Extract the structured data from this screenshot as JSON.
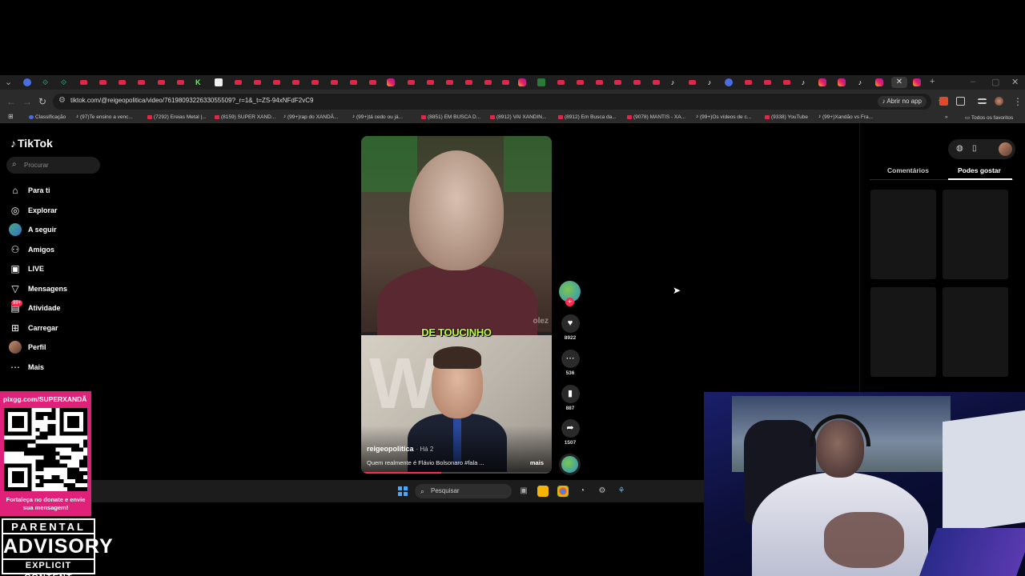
{
  "browser": {
    "url": "tiktok.com/@reigeopolitica/video/7619809322633055509?_r=1&_t=ZS-94xNFdF2vC9",
    "open_app_label": "Abrir no app",
    "bookmarks": [
      {
        "label": "Classificação",
        "icon": "google"
      },
      {
        "label": "(97)Te ensino a venc...",
        "icon": "tiktok"
      },
      {
        "label": "(7292) Ereias Metal |...",
        "icon": "youtube"
      },
      {
        "label": "(8159) SUPER XAND...",
        "icon": "youtube"
      },
      {
        "label": "(99+)rap do XANDÃ...",
        "icon": "tiktok"
      },
      {
        "label": "(99+)tá cedo ou já...",
        "icon": "tiktok"
      },
      {
        "label": "(8851) EM BUSCA D...",
        "icon": "youtube"
      },
      {
        "label": "(8912) VAI XANDIN...",
        "icon": "youtube"
      },
      {
        "label": "(8912) Em Busca da...",
        "icon": "youtube"
      },
      {
        "label": "(9078) MANTIS - XA...",
        "icon": "youtube"
      },
      {
        "label": "(99+)Os vídeos de c...",
        "icon": "tiktok"
      },
      {
        "label": "(9338) YouTube",
        "icon": "youtube"
      },
      {
        "label": "(99+)Xandão vs Fra...",
        "icon": "tiktok"
      }
    ],
    "all_bookmarks_label": "Todos os favoritos",
    "accent_color": "#fe2c55"
  },
  "tiktok": {
    "logo": "TikTok",
    "search_placeholder": "Procurar",
    "nav": [
      {
        "label": "Para ti",
        "icon": "home-icon"
      },
      {
        "label": "Explorar",
        "icon": "compass-icon"
      },
      {
        "label": "A seguir",
        "icon": "avatar"
      },
      {
        "label": "Amigos",
        "icon": "friends-icon"
      },
      {
        "label": "LIVE",
        "icon": "live-icon"
      },
      {
        "label": "Mensagens",
        "icon": "messages-icon"
      },
      {
        "label": "Atividade",
        "icon": "activity-icon",
        "badge": "99+"
      },
      {
        "label": "Carregar",
        "icon": "upload-icon"
      },
      {
        "label": "Perfil",
        "icon": "avatar"
      },
      {
        "label": "Mais",
        "icon": "more-icon"
      }
    ],
    "video": {
      "headline": "DE TOUCINHO",
      "watermark": "olez",
      "author": "reigeopolitica",
      "ago": "· Há 2",
      "description": "Quem realmente é Flávio Bolsonaro #fala ...",
      "more_label": "mais",
      "progress": 0.42
    },
    "actions": {
      "likes": "8922",
      "comments": "536",
      "saves": "887",
      "shares": "1507"
    },
    "right_tabs": [
      "Comentários",
      "Podes gostar"
    ],
    "right_active_tab": "Podes gostar"
  },
  "taskbar": {
    "search_label": "Pesquisar"
  },
  "overlays": {
    "pix_url": "pixgg.com/SUPERXANDÃ",
    "pix_message": "Fortaleça no donate e envie sua mensagem!",
    "advisory_line1": "PARENTAL",
    "advisory_line2": "ADVISORY",
    "advisory_line3": "EXPLICIT CONTENT"
  }
}
